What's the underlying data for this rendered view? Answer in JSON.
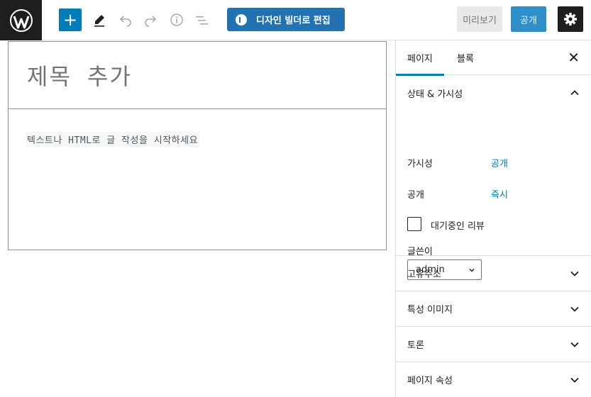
{
  "toolbar": {
    "elementor_label": "디자인 빌더로 편집",
    "preview_label": "미리보기",
    "publish_label": "공개",
    "icons": {
      "logo": "wordpress-logo-icon",
      "add": "plus-icon",
      "tools": "pencil-icon",
      "undo": "undo-icon",
      "redo": "redo-icon",
      "info": "info-icon",
      "outline": "list-view-icon",
      "settings": "gear-icon"
    }
  },
  "editor": {
    "title_placeholder": "제목 추가",
    "content_placeholder": "텍스트나 HTML로 글 작성을 시작하세요"
  },
  "sidebar": {
    "tabs": [
      {
        "label": "페이지",
        "active": true
      },
      {
        "label": "블록",
        "active": false
      }
    ],
    "close_icon": "close-icon",
    "status_panel": {
      "title": "상태 & 가시성",
      "visibility_label": "가시성",
      "visibility_value": "공개",
      "publish_label": "공개",
      "publish_value": "즉시",
      "pending_review_label": "대기중인 리뷰",
      "author_label": "글쓴이",
      "author_value": "admin"
    },
    "panels": [
      {
        "title": "고유주소"
      },
      {
        "title": "특성 이미지"
      },
      {
        "title": "토론"
      },
      {
        "title": "페이지 속성"
      }
    ]
  },
  "colors": {
    "accent": "#007cba",
    "dark": "#1e1e1e",
    "elementor": "#2271b1"
  }
}
